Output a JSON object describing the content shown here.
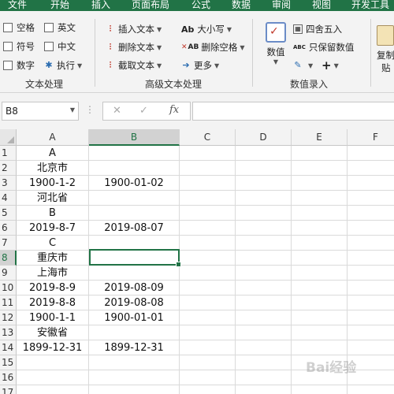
{
  "tabs": [
    "文件",
    "开始",
    "插入",
    "页面布局",
    "公式",
    "数据",
    "审阅",
    "视图",
    "开发工具"
  ],
  "ribbon": {
    "text_processing": {
      "items": [
        "空格",
        "英文",
        "符号",
        "中文",
        "数字"
      ],
      "execute": "执行",
      "label": "文本处理"
    },
    "advanced_text": {
      "insert_text": "插入文本",
      "delete_text": "删除文本",
      "extract_text": "截取文本",
      "case": "大小写",
      "delete_spaces": "删除空格",
      "more": "更多",
      "case_icon": "Ab",
      "delete_spaces_icon": "AB",
      "label": "高级文本处理"
    },
    "numeric_entry": {
      "number": "数值",
      "round": "四舍五入",
      "keep_numbers": "只保留数值",
      "keep_icon": "ABC",
      "label": "数值录入"
    },
    "copy": {
      "label_line1": "复制",
      "label_line2": "贴"
    }
  },
  "formula_bar": {
    "name_box": "B8",
    "fx": "fx",
    "cancel": "✕",
    "confirm": "✓",
    "value": ""
  },
  "sheet": {
    "columns": [
      "A",
      "B",
      "C",
      "D",
      "E",
      "F"
    ],
    "selected_column": "B",
    "selected_cell": "B8",
    "rows": [
      {
        "n": "1",
        "a": "A",
        "b": ""
      },
      {
        "n": "2",
        "a": "北京市",
        "b": ""
      },
      {
        "n": "3",
        "a": "1900-1-2",
        "b": "1900-01-02"
      },
      {
        "n": "4",
        "a": "河北省",
        "b": ""
      },
      {
        "n": "5",
        "a": "B",
        "b": ""
      },
      {
        "n": "6",
        "a": "2019-8-7",
        "b": "2019-08-07"
      },
      {
        "n": "7",
        "a": "C",
        "b": ""
      },
      {
        "n": "8",
        "a": "重庆市",
        "b": ""
      },
      {
        "n": "9",
        "a": "上海市",
        "b": ""
      },
      {
        "n": "10",
        "a": "2019-8-9",
        "b": "2019-08-09"
      },
      {
        "n": "11",
        "a": "2019-8-8",
        "b": "2019-08-08"
      },
      {
        "n": "12",
        "a": "1900-1-1",
        "b": "1900-01-01"
      },
      {
        "n": "13",
        "a": "安徽省",
        "b": ""
      },
      {
        "n": "14",
        "a": "1899-12-31",
        "b": "1899-12-31"
      },
      {
        "n": "15",
        "a": "",
        "b": ""
      },
      {
        "n": "16",
        "a": "",
        "b": ""
      },
      {
        "n": "17",
        "a": "",
        "b": ""
      }
    ]
  },
  "watermark": "Bai经验",
  "colors": {
    "accent": "#217346",
    "ribbon_bg": "#f3f3f3",
    "header_selected": "#d2d2d2"
  }
}
